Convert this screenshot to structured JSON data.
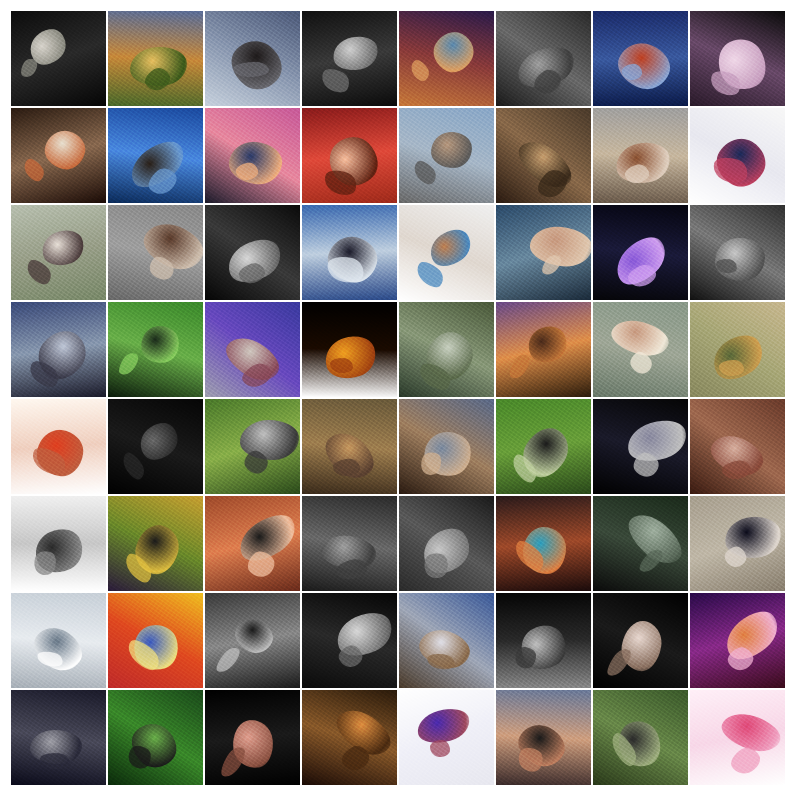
{
  "grid": {
    "rows": 8,
    "cols": 8
  },
  "tiles": [
    {
      "top": "#0c0c0c",
      "mid": "#2a2a2a",
      "bottom": "#050505",
      "shape": "#d8d4cc",
      "shape2": "#8a8a80"
    },
    {
      "top": "#5a6e9a",
      "mid": "#c88a3a",
      "bottom": "#4a6a2a",
      "shape": "#e8c060",
      "shape2": "#3a5a1a"
    },
    {
      "top": "#4c5a7a",
      "mid": "#8a98b0",
      "bottom": "#c8d2de",
      "shape": "#1e1a1a",
      "shape2": "#6a6a70"
    },
    {
      "top": "#101010",
      "mid": "#3a3a3a",
      "bottom": "#0a0a0a",
      "shape": "#cfcfcf",
      "shape2": "#707070"
    },
    {
      "top": "#2a1a4a",
      "mid": "#8a3a3a",
      "bottom": "#c87a3a",
      "shape": "#5a8ab0",
      "shape2": "#e0a060"
    },
    {
      "top": "#2a2a2a",
      "mid": "#6a6a6a",
      "bottom": "#1a1a1a",
      "shape": "#a0a0a0",
      "shape2": "#404040"
    },
    {
      "top": "#1a2a6a",
      "mid": "#3a5aa0",
      "bottom": "#0a1a4a",
      "shape": "#c04020",
      "shape2": "#8aa8d8"
    },
    {
      "top": "#0a0a0a",
      "mid": "#6a4a6a",
      "bottom": "#2a1a2a",
      "shape": "#f0d8e8",
      "shape2": "#c8a0c0"
    },
    {
      "top": "#2a1a10",
      "mid": "#8a6a50",
      "bottom": "#1a0a05",
      "shape": "#e8e0d0",
      "shape2": "#c86a3a"
    },
    {
      "top": "#1a4aa0",
      "mid": "#4a8ae0",
      "bottom": "#0a2a5a",
      "shape": "#2a2018",
      "shape2": "#6a9ad0"
    },
    {
      "top": "#c85a9a",
      "mid": "#e88aa0",
      "bottom": "#1a1a2a",
      "shape": "#2a3a6a",
      "shape2": "#f0b080"
    },
    {
      "top": "#8a1a1a",
      "mid": "#e04a3a",
      "bottom": "#a02a1a",
      "shape": "#f8c0a0",
      "shape2": "#602010"
    },
    {
      "top": "#8aa8c8",
      "mid": "#a8b8c8",
      "bottom": "#6a6a6a",
      "shape": "#b89a80",
      "shape2": "#5a5a5a"
    },
    {
      "top": "#4a3a2a",
      "mid": "#8a6a4a",
      "bottom": "#2a1a10",
      "shape": "#c8a070",
      "shape2": "#3a2a1a"
    },
    {
      "top": "#a0a0a0",
      "mid": "#c8b8a0",
      "bottom": "#6a5a4a",
      "shape": "#8a5030",
      "shape2": "#e0d0c0"
    },
    {
      "top": "#f8f8f8",
      "mid": "#e8e8f0",
      "bottom": "#ffffff",
      "shape": "#1a2a5a",
      "shape2": "#c04060"
    },
    {
      "top": "#b8c0b0",
      "mid": "#9aa08a",
      "bottom": "#7a8a6a",
      "shape": "#e8e0d8",
      "shape2": "#4a3a3a"
    },
    {
      "top": "#8a8a8a",
      "mid": "#a0a0a0",
      "bottom": "#6a6a6a",
      "shape": "#5a3a2a",
      "shape2": "#d0c0b0"
    },
    {
      "top": "#0a0a0a",
      "mid": "#3a3a3a",
      "bottom": "#050505",
      "shape": "#d8d8d8",
      "shape2": "#6a6a6a"
    },
    {
      "top": "#3a6ab0",
      "mid": "#c0d0e0",
      "bottom": "#2a4a8a",
      "shape": "#1a1a2a",
      "shape2": "#e0e8f0"
    },
    {
      "top": "#f0f0f0",
      "mid": "#e0d8d0",
      "bottom": "#ffffff",
      "shape": "#c08050",
      "shape2": "#4a8ac0"
    },
    {
      "top": "#2a4a6a",
      "mid": "#6a8aa0",
      "bottom": "#1a2a3a",
      "shape": "#c89a80",
      "shape2": "#e0c8b0"
    },
    {
      "top": "#050510",
      "mid": "#1a1a3a",
      "bottom": "#050508",
      "shape": "#8a5ad8",
      "shape2": "#d0a0f0"
    },
    {
      "top": "#303030",
      "mid": "#7a7a7a",
      "bottom": "#101010",
      "shape": "#c8c8c8",
      "shape2": "#505050"
    },
    {
      "top": "#3a4a7a",
      "mid": "#8a9ab0",
      "bottom": "#1a1a2a",
      "shape": "#c0c8d8",
      "shape2": "#3a3a4a"
    },
    {
      "top": "#3a8a2a",
      "mid": "#6ab04a",
      "bottom": "#0a1a0a",
      "shape": "#1a2a1a",
      "shape2": "#8ad060"
    },
    {
      "top": "#3a3aa0",
      "mid": "#6a4ac0",
      "bottom": "#a0a0b0",
      "shape": "#d0c8c0",
      "shape2": "#8a4a5a"
    },
    {
      "top": "#000000",
      "mid": "#1a0a00",
      "bottom": "#ffffff",
      "shape": "#f0a020",
      "shape2": "#a04010"
    },
    {
      "top": "#4a5a3a",
      "mid": "#8a9a7a",
      "bottom": "#2a3a2a",
      "shape": "#c8d0c0",
      "shape2": "#5a6a4a"
    },
    {
      "top": "#6a4a8a",
      "mid": "#e0904a",
      "bottom": "#2a1a0a",
      "shape": "#4a2a1a",
      "shape2": "#c87a3a"
    },
    {
      "top": "#8a9a8a",
      "mid": "#a0a898",
      "bottom": "#6a7a6a",
      "shape": "#c89a80",
      "shape2": "#f0e8d8"
    },
    {
      "top": "#c8b890",
      "mid": "#a8a878",
      "bottom": "#8a8a60",
      "shape": "#5a6a3a",
      "shape2": "#d0a050"
    },
    {
      "top": "#fff8f0",
      "mid": "#f0d0c0",
      "bottom": "#ffffff",
      "shape": "#e04020",
      "shape2": "#c06040"
    },
    {
      "top": "#050505",
      "mid": "#1a1a1a",
      "bottom": "#000000",
      "shape": "#6a6a6a",
      "shape2": "#2a2a2a"
    },
    {
      "top": "#4a7a2a",
      "mid": "#8ab04a",
      "bottom": "#2a4a1a",
      "shape": "#c0c0c0",
      "shape2": "#3a3a3a"
    },
    {
      "top": "#6a5a3a",
      "mid": "#a08050",
      "bottom": "#3a2a1a",
      "shape": "#c89a60",
      "shape2": "#5a4030"
    },
    {
      "top": "#5a6a8a",
      "mid": "#a08060",
      "bottom": "#2a1a10",
      "shape": "#7a8aa0",
      "shape2": "#d0b090"
    },
    {
      "top": "#4a8a2a",
      "mid": "#6aa03a",
      "bottom": "#2a4a1a",
      "shape": "#1a1a1a",
      "shape2": "#c0d0a0"
    },
    {
      "top": "#050505",
      "mid": "#1a1a2a",
      "bottom": "#000000",
      "shape": "#8a8aa0",
      "shape2": "#c0c0c0"
    },
    {
      "top": "#6a3a2a",
      "mid": "#a06a50",
      "bottom": "#3a1a10",
      "shape": "#d8b0a0",
      "shape2": "#8a4a3a"
    },
    {
      "top": "#f0f0f0",
      "mid": "#c8c8c8",
      "bottom": "#ffffff",
      "shape": "#2a2a2a",
      "shape2": "#8a8a8a"
    },
    {
      "top": "#c8a030",
      "mid": "#6a8a2a",
      "bottom": "#2a1a3a",
      "shape": "#1a1a1a",
      "shape2": "#e0c040"
    },
    {
      "top": "#a04a2a",
      "mid": "#e08050",
      "bottom": "#6a2a1a",
      "shape": "#1a1a1a",
      "shape2": "#f0c0a0"
    },
    {
      "top": "#2a2a2a",
      "mid": "#6a6a6a",
      "bottom": "#1a1a1a",
      "shape": "#a0a0a0",
      "shape2": "#404040"
    },
    {
      "top": "#1a1a1a",
      "mid": "#5a5a5a",
      "bottom": "#2a2a2a",
      "shape": "#c8c8c8",
      "shape2": "#7a7a7a"
    },
    {
      "top": "#2a1a1a",
      "mid": "#a04a2a",
      "bottom": "#1a0a0a",
      "shape": "#2aa0c0",
      "shape2": "#e08040"
    },
    {
      "top": "#1a2a1a",
      "mid": "#3a4a3a",
      "bottom": "#0a0a0a",
      "shape": "#a0b0a0",
      "shape2": "#5a6a5a"
    },
    {
      "top": "#a8a090",
      "mid": "#c0b8a8",
      "bottom": "#8a8070",
      "shape": "#0a0a1a",
      "shape2": "#e0d8d0"
    },
    {
      "top": "#c8d0d8",
      "mid": "#e8ecf0",
      "bottom": "#a8b0b8",
      "shape": "#6a7a8a",
      "shape2": "#ffffff"
    },
    {
      "top": "#f0c020",
      "mid": "#e04a20",
      "bottom": "#c02a2a",
      "shape": "#3a5ac0",
      "shape2": "#f0e080"
    },
    {
      "top": "#3a3a3a",
      "mid": "#8a8a8a",
      "bottom": "#1a1a1a",
      "shape": "#1a1a1a",
      "shape2": "#c0c0c0"
    },
    {
      "top": "#050505",
      "mid": "#2a2a2a",
      "bottom": "#0a0a0a",
      "shape": "#d8d8d8",
      "shape2": "#6a6a6a"
    },
    {
      "top": "#3a5a9a",
      "mid": "#a0a8b8",
      "bottom": "#4a3a2a",
      "shape": "#e0e0e8",
      "shape2": "#8a6a4a"
    },
    {
      "top": "#050505",
      "mid": "#2a2a2a",
      "bottom": "#8a8a8a",
      "shape": "#c0c0c0",
      "shape2": "#3a3a3a"
    },
    {
      "top": "#000000",
      "mid": "#1a1a1a",
      "bottom": "#000000",
      "shape": "#e8d8d0",
      "shape2": "#8a7060"
    },
    {
      "top": "#2a0a4a",
      "mid": "#8a2a8a",
      "bottom": "#3a0a1a",
      "shape": "#e08040",
      "shape2": "#f0b0d0"
    },
    {
      "top": "#1a1a2a",
      "mid": "#4a4a5a",
      "bottom": "#0a0a1a",
      "shape": "#a0a0a8",
      "shape2": "#2a2a3a"
    },
    {
      "top": "#1a4a1a",
      "mid": "#3a8a2a",
      "bottom": "#0a2a0a",
      "shape": "#6ab04a",
      "shape2": "#1a1a1a"
    },
    {
      "top": "#000000",
      "mid": "#1a1a1a",
      "bottom": "#000000",
      "shape": "#e0a090",
      "shape2": "#8a5040"
    },
    {
      "top": "#2a1a0a",
      "mid": "#8a5a2a",
      "bottom": "#1a0a05",
      "shape": "#e09040",
      "shape2": "#4a2a10"
    },
    {
      "top": "#ffffff",
      "mid": "#f0f0f8",
      "bottom": "#e8e8f0",
      "shape": "#4a2ab0",
      "shape2": "#a04a60"
    },
    {
      "top": "#6a7a9a",
      "mid": "#d0a080",
      "bottom": "#3a2a2a",
      "shape": "#1a1a1a",
      "shape2": "#c08060"
    },
    {
      "top": "#3a5a2a",
      "mid": "#6a8a4a",
      "bottom": "#2a3a1a",
      "shape": "#2a2a2a",
      "shape2": "#a0b080"
    },
    {
      "top": "#fff0f8",
      "mid": "#f8d8e8",
      "bottom": "#ffffff",
      "shape": "#e04a7a",
      "shape2": "#f0a0c0"
    }
  ]
}
